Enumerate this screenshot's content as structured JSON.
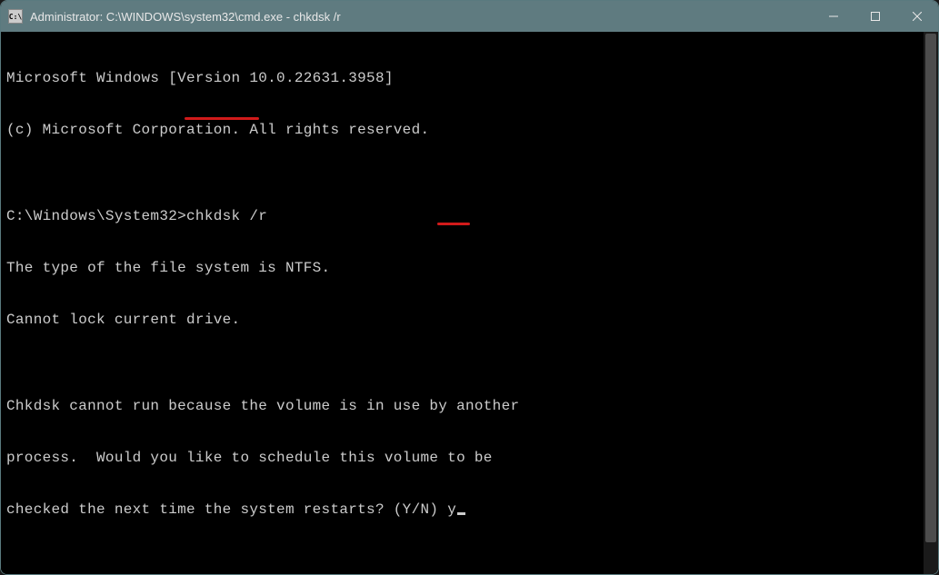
{
  "titlebar": {
    "icon_text": "C:\\",
    "title": "Administrator: C:\\WINDOWS\\system32\\cmd.exe - chkdsk  /r"
  },
  "terminal": {
    "line1": "Microsoft Windows [Version 10.0.22631.3958]",
    "line2": "(c) Microsoft Corporation. All rights reserved.",
    "blank1": "",
    "prompt_path": "C:\\Windows\\System32>",
    "command": "chkdsk /r",
    "out1": "The type of the file system is NTFS.",
    "out2": "Cannot lock current drive.",
    "blank2": "",
    "out3": "Chkdsk cannot run because the volume is in use by another",
    "out4": "process.  Would you like to schedule this volume to be",
    "out5_prefix": "checked the next time the system restarts? (Y/N) ",
    "user_input": "y"
  }
}
